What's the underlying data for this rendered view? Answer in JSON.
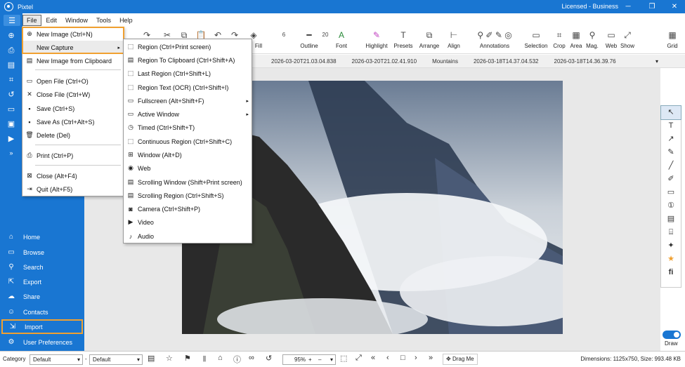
{
  "app": {
    "title": "Pixtel",
    "license": "Licensed - Business"
  },
  "menubar": [
    "File",
    "Edit",
    "Window",
    "Tools",
    "Help"
  ],
  "toolbar": [
    {
      "label": "Fill",
      "icon": "fill-icon"
    },
    {
      "label": "Outline",
      "icon": "outline-icon"
    },
    {
      "label": "Font",
      "icon": "font-icon",
      "value": "20"
    },
    {
      "label": "Highlight",
      "icon": "highlight-icon"
    },
    {
      "label": "Presets",
      "icon": "presets-icon"
    },
    {
      "label": "Arrange",
      "icon": "arrange-icon"
    },
    {
      "label": "Align",
      "icon": "align-icon"
    },
    {
      "label": "Annotations",
      "icon": "annotations-icon"
    },
    {
      "label": "Selection",
      "icon": "selection-icon"
    },
    {
      "label": "Crop",
      "icon": "crop-icon"
    },
    {
      "label": "Area",
      "icon": "area-icon"
    },
    {
      "label": "Mag.",
      "icon": "magnify-icon"
    },
    {
      "label": "Web",
      "icon": "web-icon"
    },
    {
      "label": "Show",
      "icon": "show-icon"
    },
    {
      "label": "Grid",
      "icon": "grid-icon"
    }
  ],
  "toolbar_values": {
    "stroke_width": "6"
  },
  "tabs": [
    "2026-03-20T21.03.04.838",
    "2026-03-20T21.02.41.910",
    "Mountains",
    "2026-03-18T14.37.04.532",
    "2026-03-18T14.36.39.76"
  ],
  "sidebar_nav": [
    {
      "label": "Home",
      "icon": "home-icon"
    },
    {
      "label": "Browse",
      "icon": "browse-icon"
    },
    {
      "label": "Search",
      "icon": "search-icon"
    },
    {
      "label": "Export",
      "icon": "export-icon"
    },
    {
      "label": "Share",
      "icon": "share-icon"
    },
    {
      "label": "Contacts",
      "icon": "contacts-icon"
    },
    {
      "label": "Import",
      "icon": "import-icon"
    },
    {
      "label": "User Preferences",
      "icon": "user-preferences-icon"
    }
  ],
  "file_menu": [
    {
      "label": "New Image (Ctrl+N)",
      "icon": "new-image-icon"
    },
    {
      "label": "New Capture",
      "icon": "",
      "submenu": true
    },
    {
      "label": "New Image from Clipboard",
      "icon": "clipboard-icon"
    },
    {
      "label": "Open File (Ctrl+O)",
      "icon": "open-file-icon"
    },
    {
      "label": "Close File (Ctrl+W)",
      "icon": "close-file-icon"
    },
    {
      "label": "Save (Ctrl+S)",
      "icon": "save-icon"
    },
    {
      "label": "Save As (Ctrl+Alt+S)",
      "icon": "save-as-icon"
    },
    {
      "label": "Delete (Del)",
      "icon": "delete-icon"
    },
    {
      "label": "Print (Ctrl+P)",
      "icon": "print-icon"
    },
    {
      "label": "Close (Alt+F4)",
      "icon": "close-icon"
    },
    {
      "label": "Quit (Alt+F5)",
      "icon": "quit-icon"
    }
  ],
  "capture_menu": [
    {
      "label": "Region (Ctrl+Print screen)",
      "icon": "region-icon"
    },
    {
      "label": "Region To Clipboard (Ctrl+Shift+A)",
      "icon": "region-clipboard-icon"
    },
    {
      "label": "Last Region (Ctrl+Shift+L)",
      "icon": "last-region-icon"
    },
    {
      "label": "Region Text (OCR) (Ctrl+Shift+I)",
      "icon": "ocr-icon"
    },
    {
      "label": "Fullscreen (Alt+Shift+F)",
      "icon": "fullscreen-icon",
      "submenu": true
    },
    {
      "label": "Active Window",
      "icon": "active-window-icon",
      "submenu": true
    },
    {
      "label": "Timed (Ctrl+Shift+T)",
      "icon": "timer-icon"
    },
    {
      "label": "Continuous Region (Ctrl+Shift+C)",
      "icon": "continuous-region-icon"
    },
    {
      "label": "Window (Alt+D)",
      "icon": "window-icon"
    },
    {
      "label": "Web",
      "icon": "web-icon"
    },
    {
      "label": "Scrolling Window (Shift+Print screen)",
      "icon": "scrolling-window-icon"
    },
    {
      "label": "Scrolling Region (Ctrl+Shift+S)",
      "icon": "scrolling-region-icon"
    },
    {
      "label": "Camera (Ctrl+Shift+P)",
      "icon": "camera-icon"
    },
    {
      "label": "Video",
      "icon": "video-icon"
    },
    {
      "label": "Audio",
      "icon": "audio-icon"
    }
  ],
  "statusbar": {
    "category_label": "Category",
    "category_value": "Default",
    "preset_value": "Default",
    "zoom": "95%",
    "drag_me": "Drag Me",
    "dimensions": "Dimensions: 1125x750, Size: 993.48 KB"
  },
  "draw": {
    "label": "Draw",
    "enabled": true
  },
  "colors": {
    "accent": "#1976d2",
    "highlight": "#f0a030"
  }
}
